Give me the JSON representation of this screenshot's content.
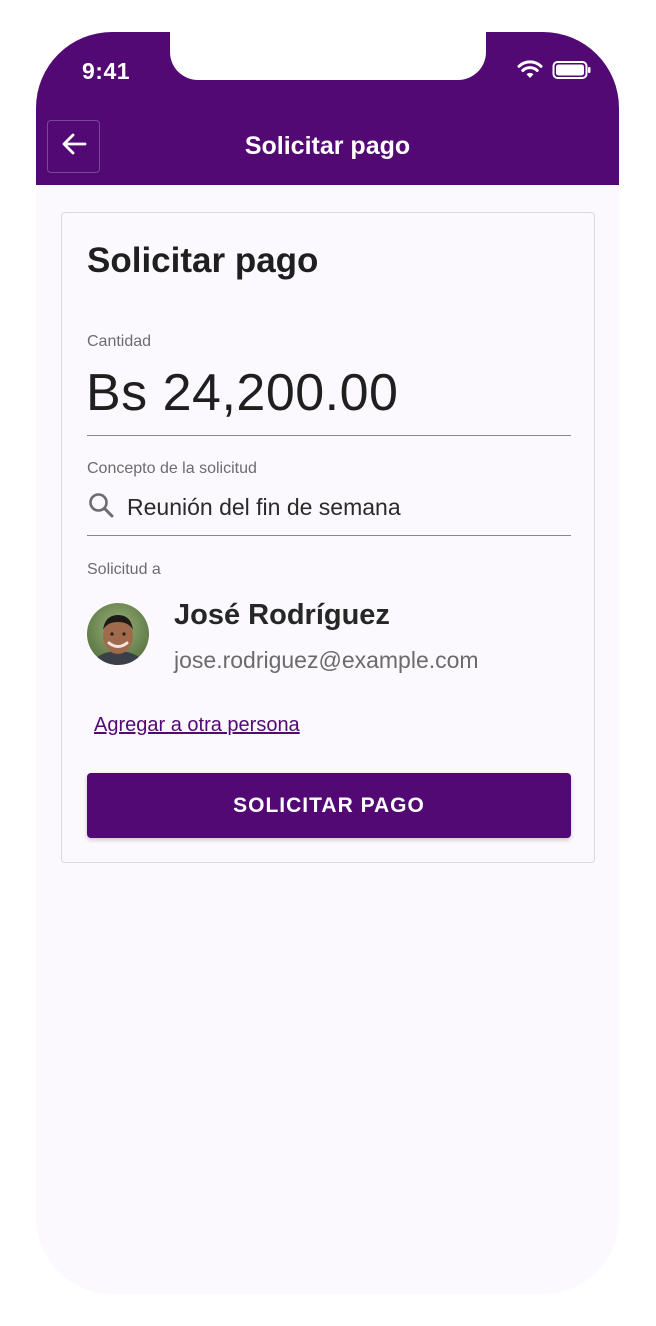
{
  "status_bar": {
    "time": "9:41",
    "icons": [
      "wifi-icon",
      "battery-icon"
    ]
  },
  "header": {
    "back_icon": "arrow-left-icon",
    "title": "Solicitar pago"
  },
  "card": {
    "title": "Solicitar pago",
    "amount_label": "Cantidad",
    "amount_value": "Bs 24,200.00",
    "concept_label": "Concepto de la solicitud",
    "concept_icon": "search-icon",
    "concept_value": "Reunión del fin de semana",
    "recipient_label": "Solicitud a",
    "recipient": {
      "name": "José Rodríguez",
      "email": "jose.rodriguez@example.com"
    },
    "add_person_link": "Agregar a otra persona",
    "submit_label": "SOLICITAR PAGO"
  },
  "colors": {
    "brand": "#520974",
    "background": "#fbf9fd",
    "text_primary": "#1f1f1f",
    "text_secondary": "#6d6b70"
  }
}
